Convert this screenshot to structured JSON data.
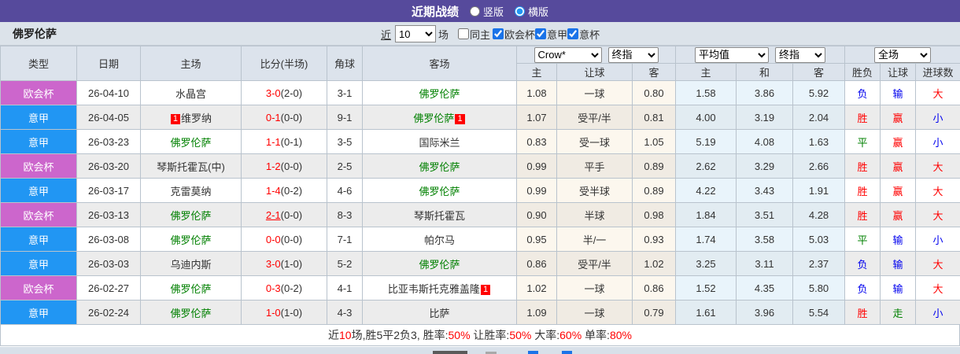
{
  "titlebar": {
    "title": "近期战绩",
    "radio_vertical": "竖版",
    "radio_horizontal": "横版",
    "selected_layout": "横版"
  },
  "filterbar": {
    "team": "佛罗伦萨",
    "near_label": "近",
    "near_value": "10",
    "matches_label": "场",
    "same_home_label": "同主",
    "league_filters": [
      "欧会杯",
      "意甲",
      "意杯"
    ]
  },
  "colors": {
    "titlebar_purple": "#564a9c",
    "score_red": "#ff0000",
    "team_green": "#008000",
    "result_blue": "#0000ee",
    "league": {
      "欧会杯": "#cc66cc",
      "意甲": "#2196f3"
    }
  },
  "table": {
    "left_headers": [
      "类型",
      "日期",
      "主场",
      "比分(半场)",
      "角球",
      "客场"
    ],
    "selects": {
      "company": "Crow*",
      "stage1": "终指",
      "average": "平均值",
      "stage2": "终指",
      "scope": "全场"
    },
    "sub_headers": [
      "主",
      "让球",
      "客",
      "主",
      "和",
      "客",
      "胜负",
      "让球",
      "进球数"
    ],
    "rows": [
      {
        "league": "欧会杯",
        "date": "26-04-10",
        "home": {
          "name": "水晶宫",
          "green": false,
          "card": null,
          "card_pos": null
        },
        "score": {
          "ft": "3-0",
          "ht": "2-0",
          "underline": false
        },
        "corner": "3-1",
        "away": {
          "name": "佛罗伦萨",
          "green": true,
          "card": null,
          "card_pos": null
        },
        "odds": [
          "1.08",
          "一球",
          "0.80"
        ],
        "avg": [
          "1.58",
          "3.86",
          "5.92"
        ],
        "results": [
          {
            "text": "负",
            "color": "blue"
          },
          {
            "text": "输",
            "color": "blue"
          },
          {
            "text": "大",
            "color": "red"
          }
        ]
      },
      {
        "league": "意甲",
        "date": "26-04-05",
        "home": {
          "name": "维罗纳",
          "green": false,
          "card": "1",
          "card_pos": "before"
        },
        "score": {
          "ft": "0-1",
          "ht": "0-0",
          "underline": false
        },
        "corner": "9-1",
        "away": {
          "name": "佛罗伦萨",
          "green": true,
          "card": "1",
          "card_pos": "after"
        },
        "odds": [
          "1.07",
          "受平/半",
          "0.81"
        ],
        "avg": [
          "4.00",
          "3.19",
          "2.04"
        ],
        "results": [
          {
            "text": "胜",
            "color": "red"
          },
          {
            "text": "赢",
            "color": "red"
          },
          {
            "text": "小",
            "color": "blue"
          }
        ]
      },
      {
        "league": "意甲",
        "date": "26-03-23",
        "home": {
          "name": "佛罗伦萨",
          "green": true,
          "card": null,
          "card_pos": null
        },
        "score": {
          "ft": "1-1",
          "ht": "0-1",
          "underline": false
        },
        "corner": "3-5",
        "away": {
          "name": "国际米兰",
          "green": false,
          "card": null,
          "card_pos": null
        },
        "odds": [
          "0.83",
          "受一球",
          "1.05"
        ],
        "avg": [
          "5.19",
          "4.08",
          "1.63"
        ],
        "results": [
          {
            "text": "平",
            "color": "green"
          },
          {
            "text": "赢",
            "color": "red"
          },
          {
            "text": "小",
            "color": "blue"
          }
        ]
      },
      {
        "league": "欧会杯",
        "date": "26-03-20",
        "home": {
          "name": "琴斯托霍瓦(中)",
          "green": false,
          "card": null,
          "card_pos": null
        },
        "score": {
          "ft": "1-2",
          "ht": "0-0",
          "underline": false
        },
        "corner": "2-5",
        "away": {
          "name": "佛罗伦萨",
          "green": true,
          "card": null,
          "card_pos": null
        },
        "odds": [
          "0.99",
          "平手",
          "0.89"
        ],
        "avg": [
          "2.62",
          "3.29",
          "2.66"
        ],
        "results": [
          {
            "text": "胜",
            "color": "red"
          },
          {
            "text": "赢",
            "color": "red"
          },
          {
            "text": "大",
            "color": "red"
          }
        ]
      },
      {
        "league": "意甲",
        "date": "26-03-17",
        "home": {
          "name": "克雷莫纳",
          "green": false,
          "card": null,
          "card_pos": null
        },
        "score": {
          "ft": "1-4",
          "ht": "0-2",
          "underline": false
        },
        "corner": "4-6",
        "away": {
          "name": "佛罗伦萨",
          "green": true,
          "card": null,
          "card_pos": null
        },
        "odds": [
          "0.99",
          "受半球",
          "0.89"
        ],
        "avg": [
          "4.22",
          "3.43",
          "1.91"
        ],
        "results": [
          {
            "text": "胜",
            "color": "red"
          },
          {
            "text": "赢",
            "color": "red"
          },
          {
            "text": "大",
            "color": "red"
          }
        ]
      },
      {
        "league": "欧会杯",
        "date": "26-03-13",
        "home": {
          "name": "佛罗伦萨",
          "green": true,
          "card": null,
          "card_pos": null
        },
        "score": {
          "ft": "2-1",
          "ht": "0-0",
          "underline": true
        },
        "corner": "8-3",
        "away": {
          "name": "琴斯托霍瓦",
          "green": false,
          "card": null,
          "card_pos": null
        },
        "odds": [
          "0.90",
          "半球",
          "0.98"
        ],
        "avg": [
          "1.84",
          "3.51",
          "4.28"
        ],
        "results": [
          {
            "text": "胜",
            "color": "red"
          },
          {
            "text": "赢",
            "color": "red"
          },
          {
            "text": "大",
            "color": "red"
          }
        ]
      },
      {
        "league": "意甲",
        "date": "26-03-08",
        "home": {
          "name": "佛罗伦萨",
          "green": true,
          "card": null,
          "card_pos": null
        },
        "score": {
          "ft": "0-0",
          "ht": "0-0",
          "underline": false
        },
        "corner": "7-1",
        "away": {
          "name": "帕尔马",
          "green": false,
          "card": null,
          "card_pos": null
        },
        "odds": [
          "0.95",
          "半/一",
          "0.93"
        ],
        "avg": [
          "1.74",
          "3.58",
          "5.03"
        ],
        "results": [
          {
            "text": "平",
            "color": "green"
          },
          {
            "text": "输",
            "color": "blue"
          },
          {
            "text": "小",
            "color": "blue"
          }
        ]
      },
      {
        "league": "意甲",
        "date": "26-03-03",
        "home": {
          "name": "乌迪内斯",
          "green": false,
          "card": null,
          "card_pos": null
        },
        "score": {
          "ft": "3-0",
          "ht": "1-0",
          "underline": false
        },
        "corner": "5-2",
        "away": {
          "name": "佛罗伦萨",
          "green": true,
          "card": null,
          "card_pos": null
        },
        "odds": [
          "0.86",
          "受平/半",
          "1.02"
        ],
        "avg": [
          "3.25",
          "3.11",
          "2.37"
        ],
        "results": [
          {
            "text": "负",
            "color": "blue"
          },
          {
            "text": "输",
            "color": "blue"
          },
          {
            "text": "大",
            "color": "red"
          }
        ]
      },
      {
        "league": "欧会杯",
        "date": "26-02-27",
        "home": {
          "name": "佛罗伦萨",
          "green": true,
          "card": null,
          "card_pos": null
        },
        "score": {
          "ft": "0-3",
          "ht": "0-2",
          "underline": false
        },
        "corner": "4-1",
        "away": {
          "name": "比亚韦斯托克雅盖隆",
          "green": false,
          "card": "1",
          "card_pos": "after"
        },
        "odds": [
          "1.02",
          "一球",
          "0.86"
        ],
        "avg": [
          "1.52",
          "4.35",
          "5.80"
        ],
        "results": [
          {
            "text": "负",
            "color": "blue"
          },
          {
            "text": "输",
            "color": "blue"
          },
          {
            "text": "大",
            "color": "red"
          }
        ]
      },
      {
        "league": "意甲",
        "date": "26-02-24",
        "home": {
          "name": "佛罗伦萨",
          "green": true,
          "card": null,
          "card_pos": null
        },
        "score": {
          "ft": "1-0",
          "ht": "1-0",
          "underline": false
        },
        "corner": "4-3",
        "away": {
          "name": "比萨",
          "green": false,
          "card": null,
          "card_pos": null
        },
        "odds": [
          "1.09",
          "一球",
          "0.79"
        ],
        "avg": [
          "1.61",
          "3.96",
          "5.54"
        ],
        "results": [
          {
            "text": "胜",
            "color": "red"
          },
          {
            "text": "走",
            "color": "green"
          },
          {
            "text": "小",
            "color": "blue"
          }
        ]
      }
    ]
  },
  "summary": {
    "parts": [
      {
        "text": "近",
        "red": false
      },
      {
        "text": "10",
        "red": true
      },
      {
        "text": "场,胜5平2负3, 胜率:",
        "red": false
      },
      {
        "text": "50%",
        "red": true
      },
      {
        "text": " 让胜率:",
        "red": false
      },
      {
        "text": "50%",
        "red": true
      },
      {
        "text": " 大率:",
        "red": false
      },
      {
        "text": "60%",
        "red": true
      },
      {
        "text": " 单率:",
        "red": false
      },
      {
        "text": "80%",
        "red": true
      }
    ]
  }
}
